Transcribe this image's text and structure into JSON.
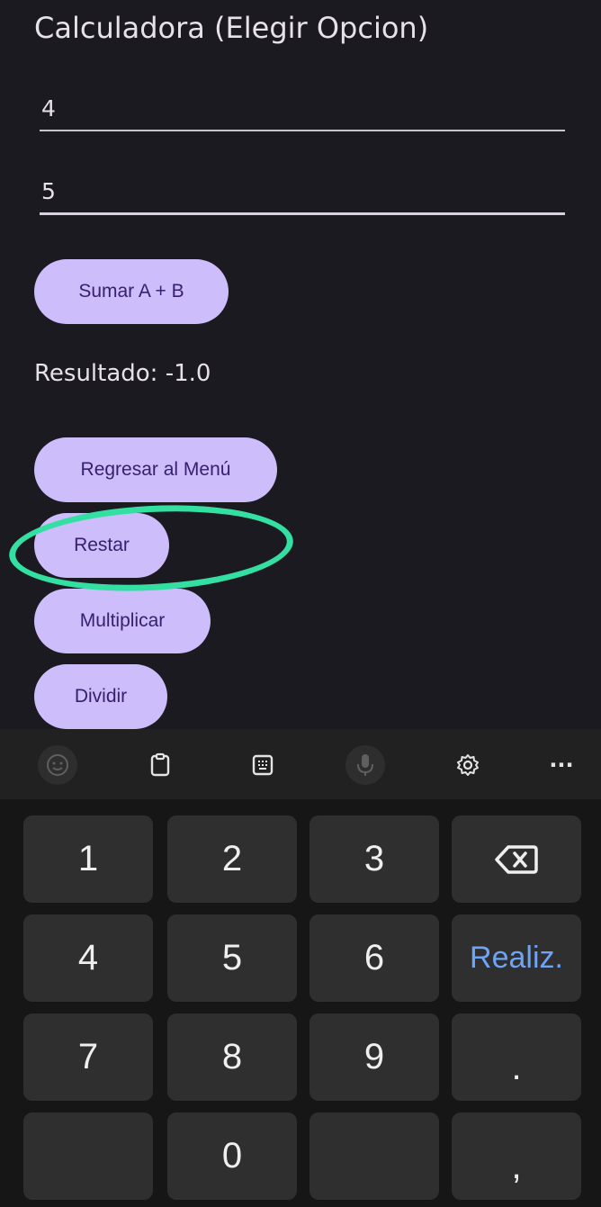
{
  "app": {
    "title": "Calculadora (Elegir Opcion)",
    "input_a": {
      "value": "4"
    },
    "input_b": {
      "value": "5"
    },
    "sum_button": "Sumar A + B",
    "result_text": "Resultado: -1.0",
    "buttons": {
      "back_menu": "Regresar al Menú",
      "subtract": "Restar",
      "multiply": "Multiplicar",
      "divide": "Dividir"
    },
    "colors": {
      "background": "#1c1a21",
      "button": "#cdbdfb",
      "button_text": "#37206f",
      "highlight": "#33e0a2"
    }
  },
  "keyboard": {
    "toolbar_icons": [
      "emoji-icon",
      "clipboard-icon",
      "keypad-icon",
      "microphone-icon",
      "settings-icon",
      "more-icon"
    ],
    "more_label": "···",
    "keys": {
      "k1": "1",
      "k2": "2",
      "k3": "3",
      "k4": "4",
      "k5": "5",
      "k6": "6",
      "k7": "7",
      "k8": "8",
      "k9": "9",
      "k0": "0",
      "done": "Realiz.",
      "period": ".",
      "comma": ","
    },
    "colors": {
      "key": "#2f2f2f",
      "done_text": "#6ea3f5"
    }
  }
}
